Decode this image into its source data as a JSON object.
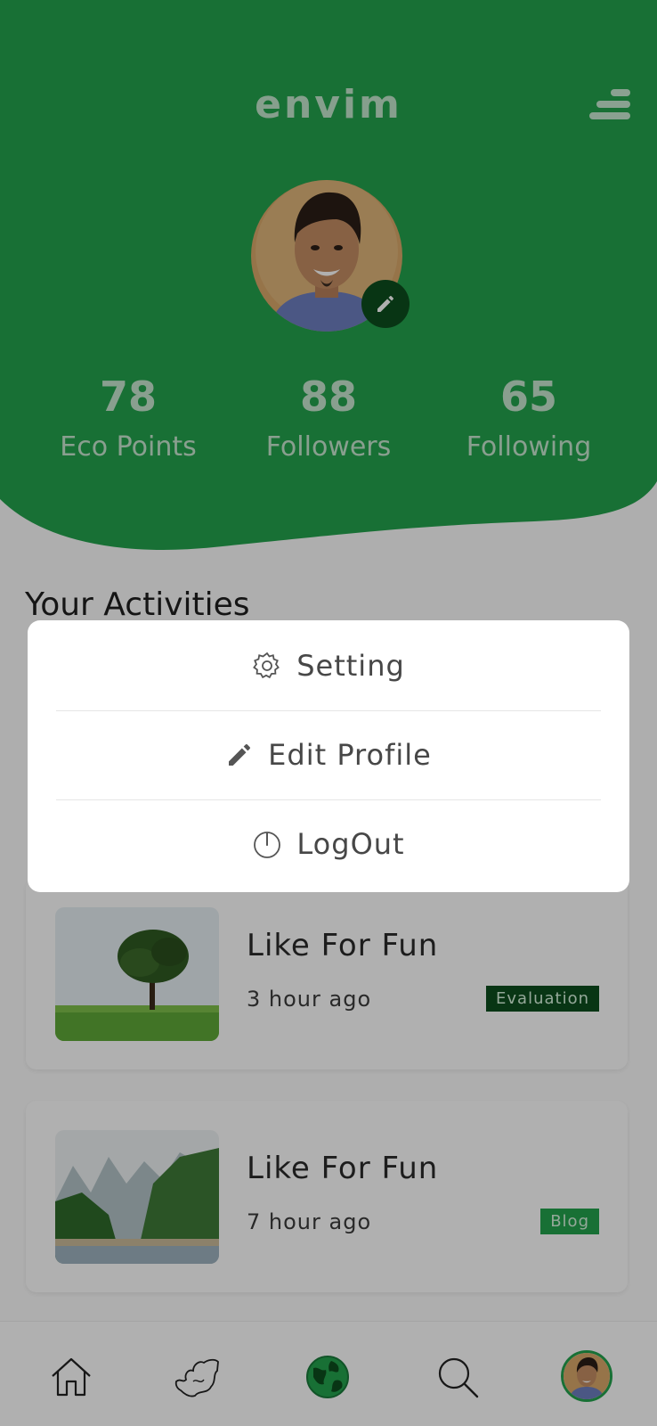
{
  "app": {
    "logo": "envim"
  },
  "profile": {
    "stats": [
      {
        "value": "78",
        "label": "Eco Points"
      },
      {
        "value": "88",
        "label": "Followers"
      },
      {
        "value": "65",
        "label": "Following"
      }
    ]
  },
  "activities": {
    "title": "Your Activities",
    "items": [
      {
        "title": "Like For Fun",
        "time": "3 hour ago",
        "tag": "Evaluation",
        "tag_color": "#0d4d1d"
      },
      {
        "title": "Like For Fun",
        "time": "7 hour ago",
        "tag": "Blog",
        "tag_color": "#24a34e"
      }
    ]
  },
  "menu": {
    "items": [
      {
        "label": "Setting",
        "icon": "gear-icon"
      },
      {
        "label": "Edit Profile",
        "icon": "pencil-icon"
      },
      {
        "label": "LogOut",
        "icon": "power-icon"
      }
    ]
  },
  "nav": {
    "items": [
      "home-icon",
      "map-icon",
      "globe-icon",
      "search-icon",
      "profile-avatar"
    ]
  },
  "colors": {
    "brand_green": "#24a34e",
    "dark_green": "#0d4d1d"
  }
}
